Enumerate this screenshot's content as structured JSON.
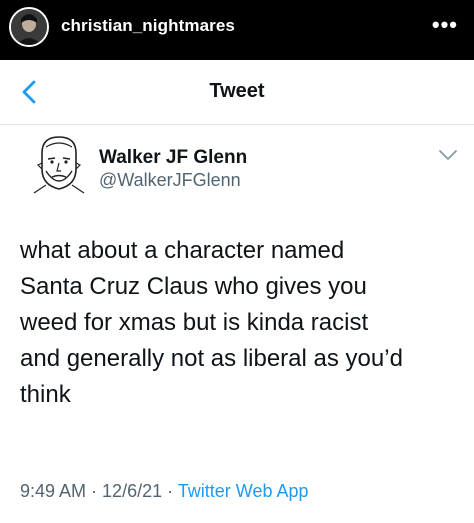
{
  "instagram": {
    "username": "christian_nightmares",
    "more_label": "•••"
  },
  "nav": {
    "title": "Tweet"
  },
  "tweet": {
    "author_name": "Walker JF Glenn",
    "author_handle": "@WalkerJFGlenn",
    "text": "what about a character named\nSanta Cruz Claus who gives you\nweed for xmas but is kinda racist\nand generally not as liberal as you’d\nthink",
    "time": "9:49 AM",
    "separator": " · ",
    "date": "12/6/21",
    "source": "Twitter Web App"
  },
  "colors": {
    "accent": "#1d9bf0",
    "text": "#0f1419",
    "secondary": "#536471"
  }
}
